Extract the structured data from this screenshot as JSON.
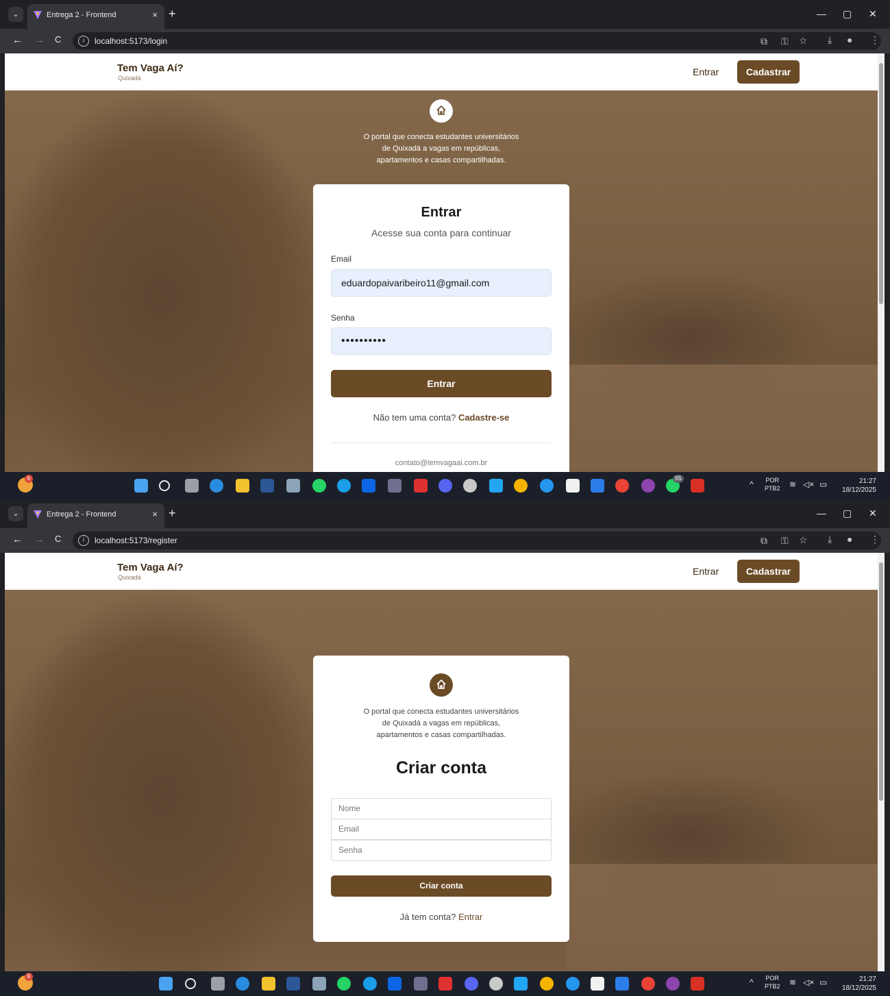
{
  "browser": {
    "tab_title": "Entrega 2 - Frontend",
    "tab_close": "×",
    "new_tab": "+",
    "menu": "⌄",
    "back": "←",
    "forward": "→",
    "reload": "C",
    "info_icon": "i",
    "url_login": "localhost:5173/login",
    "url_register": "localhost:5173/register"
  },
  "header": {
    "brand_title": "Tem Vaga Aí?",
    "brand_sub": "Quixadá",
    "entrar": "Entrar",
    "cadastrar": "Cadastrar"
  },
  "tagline": {
    "line1": "O portal que conecta estudantes universitários",
    "line2": "de Quixadá a vagas em repúblicas,",
    "line3": "apartamentos e casas compartilhadas."
  },
  "login": {
    "title": "Entrar",
    "subtitle": "Acesse sua conta para continuar",
    "email_label": "Email",
    "email_value": "eduardopaivaribeiro11@gmail.com",
    "password_label": "Senha",
    "password_value": "••••••••••",
    "submit": "Entrar",
    "no_account": "Não tem uma conta?",
    "signup_link": "Cadastre-se",
    "contact": "contato@temvagaai.com.br"
  },
  "register": {
    "title": "Criar conta",
    "name_placeholder": "Nome",
    "email_placeholder": "Email",
    "password_placeholder": "Senha",
    "submit": "Criar conta",
    "have_account": "Já tem conta?",
    "login_link": "Entrar"
  },
  "taskbar": {
    "weather_badge": "6",
    "whatsapp_badge": "55",
    "lang": "POR",
    "layout": "PTB2",
    "time": "21:27",
    "date": "18/12/2025",
    "chevron": "^"
  },
  "colors": {
    "brand": "#6b4a26",
    "header_bg": "#ffffff"
  }
}
